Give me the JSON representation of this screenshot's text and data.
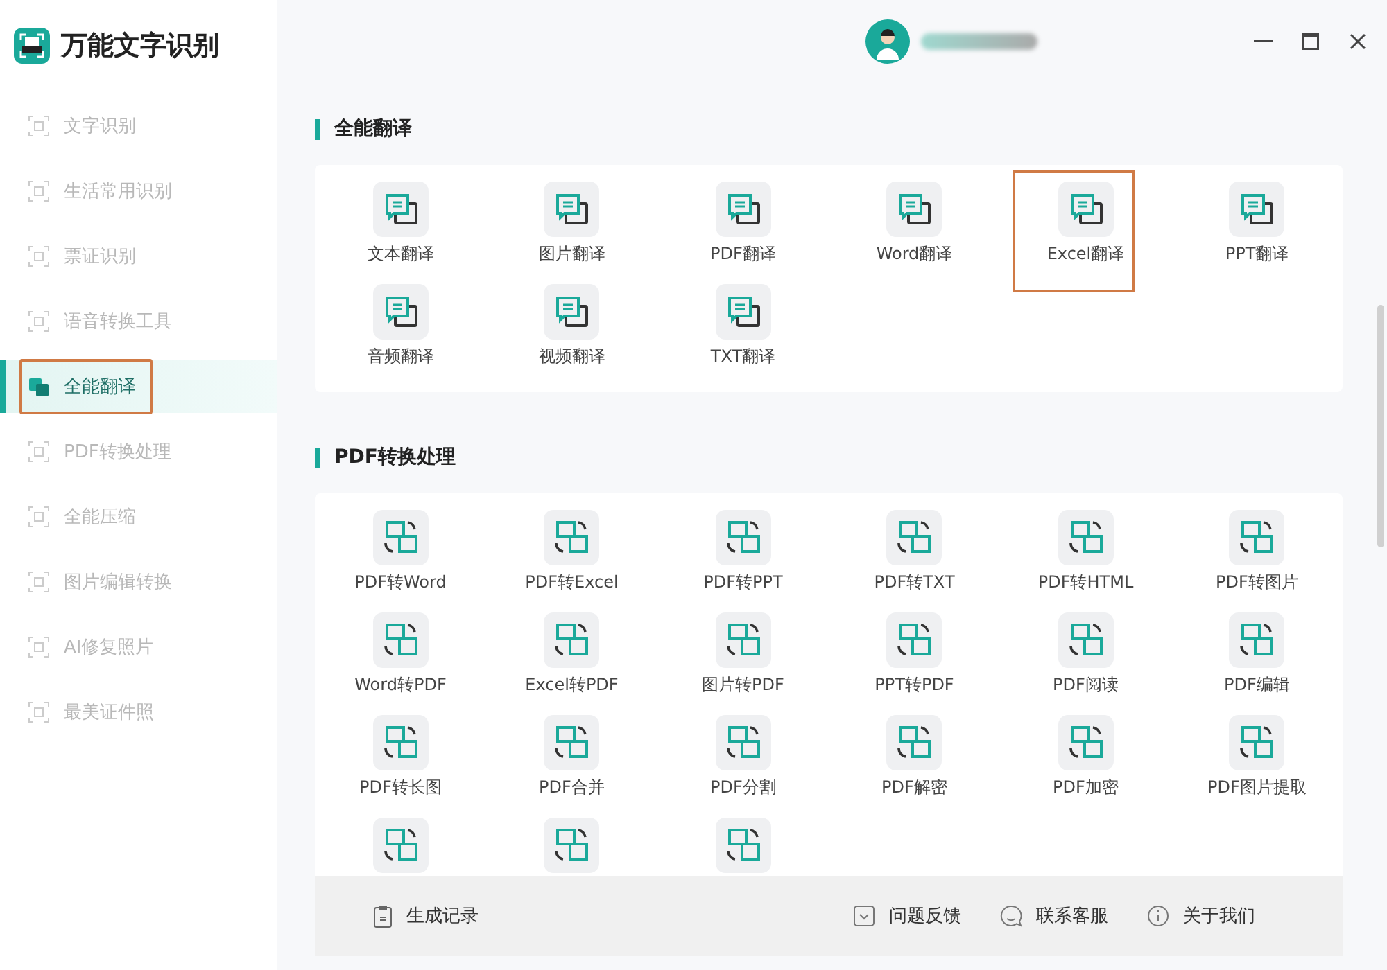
{
  "app": {
    "title": "万能文字识别"
  },
  "sidebar": {
    "items": [
      {
        "label": "文字识别",
        "selected": false,
        "highlighted": false
      },
      {
        "label": "生活常用识别",
        "selected": false,
        "highlighted": false
      },
      {
        "label": "票证识别",
        "selected": false,
        "highlighted": false
      },
      {
        "label": "语音转换工具",
        "selected": false,
        "highlighted": false
      },
      {
        "label": "全能翻译",
        "selected": true,
        "highlighted": true
      },
      {
        "label": "PDF转换处理",
        "selected": false,
        "highlighted": false
      },
      {
        "label": "全能压缩",
        "selected": false,
        "highlighted": false
      },
      {
        "label": "图片编辑转换",
        "selected": false,
        "highlighted": false
      },
      {
        "label": "AI修复照片",
        "selected": false,
        "highlighted": false
      },
      {
        "label": "最美证件照",
        "selected": false,
        "highlighted": false
      }
    ]
  },
  "sections": [
    {
      "title": "全能翻译",
      "kind": "translate",
      "tools": [
        {
          "label": "文本翻译",
          "highlighted": false
        },
        {
          "label": "图片翻译",
          "highlighted": false
        },
        {
          "label": "PDF翻译",
          "highlighted": false
        },
        {
          "label": "Word翻译",
          "highlighted": false
        },
        {
          "label": "Excel翻译",
          "highlighted": true
        },
        {
          "label": "PPT翻译",
          "highlighted": false
        },
        {
          "label": "音频翻译",
          "highlighted": false
        },
        {
          "label": "视频翻译",
          "highlighted": false
        },
        {
          "label": "TXT翻译",
          "highlighted": false
        }
      ]
    },
    {
      "title": "PDF转换处理",
      "kind": "convert",
      "tools": [
        {
          "label": "PDF转Word",
          "highlighted": false
        },
        {
          "label": "PDF转Excel",
          "highlighted": false
        },
        {
          "label": "PDF转PPT",
          "highlighted": false
        },
        {
          "label": "PDF转TXT",
          "highlighted": false
        },
        {
          "label": "PDF转HTML",
          "highlighted": false
        },
        {
          "label": "PDF转图片",
          "highlighted": false
        },
        {
          "label": "Word转PDF",
          "highlighted": false
        },
        {
          "label": "Excel转PDF",
          "highlighted": false
        },
        {
          "label": "图片转PDF",
          "highlighted": false
        },
        {
          "label": "PPT转PDF",
          "highlighted": false
        },
        {
          "label": "PDF阅读",
          "highlighted": false
        },
        {
          "label": "PDF编辑",
          "highlighted": false
        },
        {
          "label": "PDF转长图",
          "highlighted": false
        },
        {
          "label": "PDF合并",
          "highlighted": false
        },
        {
          "label": "PDF分割",
          "highlighted": false
        },
        {
          "label": "PDF解密",
          "highlighted": false
        },
        {
          "label": "PDF加密",
          "highlighted": false
        },
        {
          "label": "PDF图片提取",
          "highlighted": false
        },
        {
          "highlighted": false
        },
        {
          "highlighted": false
        },
        {
          "highlighted": false
        }
      ]
    }
  ],
  "footer": {
    "left": {
      "label": "生成记录"
    },
    "links": [
      {
        "label": "问题反馈",
        "kind": "feedback"
      },
      {
        "label": "联系客服",
        "kind": "chat"
      },
      {
        "label": "关于我们",
        "kind": "info"
      }
    ]
  }
}
